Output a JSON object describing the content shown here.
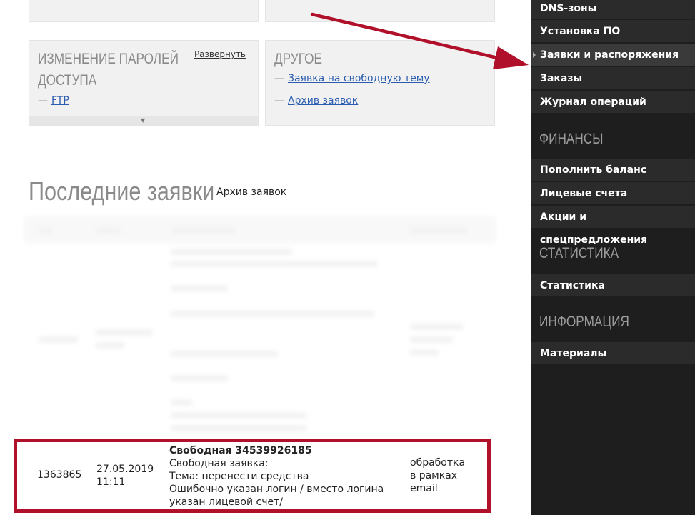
{
  "cards": {
    "password": {
      "title_line1": "ИЗМЕНЕНИЕ ПАРОЛЕЙ",
      "title_line2": "ДОСТУПА",
      "expand_label": "Развернуть",
      "links": [
        "FTP"
      ],
      "collapse_icon": "chevron-down-icon"
    },
    "other": {
      "title": "ДРУГОЕ",
      "links": [
        "Заявка на свободную тему",
        "Архив заявок"
      ]
    }
  },
  "requests": {
    "title": "Последние заявки",
    "archive_link": "Архив заявок",
    "highlighted_row": {
      "id": "1363865",
      "date": "27.05.2019",
      "time": "11:11",
      "text_title": "Свободная 34539926185",
      "text_lines": [
        "Свободная заявка:",
        "Тема: перенести средства",
        "Ошибочно указан логин / вместо логина",
        "указан лицевой счет/"
      ],
      "status_lines": [
        "обработка",
        "в рамках",
        "email"
      ]
    }
  },
  "sidebar": {
    "top_items": [
      {
        "label": "DNS-зоны"
      },
      {
        "label": "Установка ПО"
      },
      {
        "label": "Заявки и распоряжения",
        "active": true
      },
      {
        "label": "Заказы"
      },
      {
        "label": "Журнал операций"
      }
    ],
    "sections": [
      {
        "heading": "ФИНАНСЫ",
        "items": [
          "Пополнить баланс",
          "Лицевые счета",
          "Акции и спецпредложения"
        ]
      },
      {
        "heading": "СТАТИСТИКА",
        "items": [
          "Статистика"
        ]
      },
      {
        "heading": "ИНФОРМАЦИЯ",
        "items": [
          "Материалы"
        ]
      }
    ]
  },
  "annotation": {
    "arrow_color": "#b0102a",
    "highlight_color": "#b0102a"
  }
}
